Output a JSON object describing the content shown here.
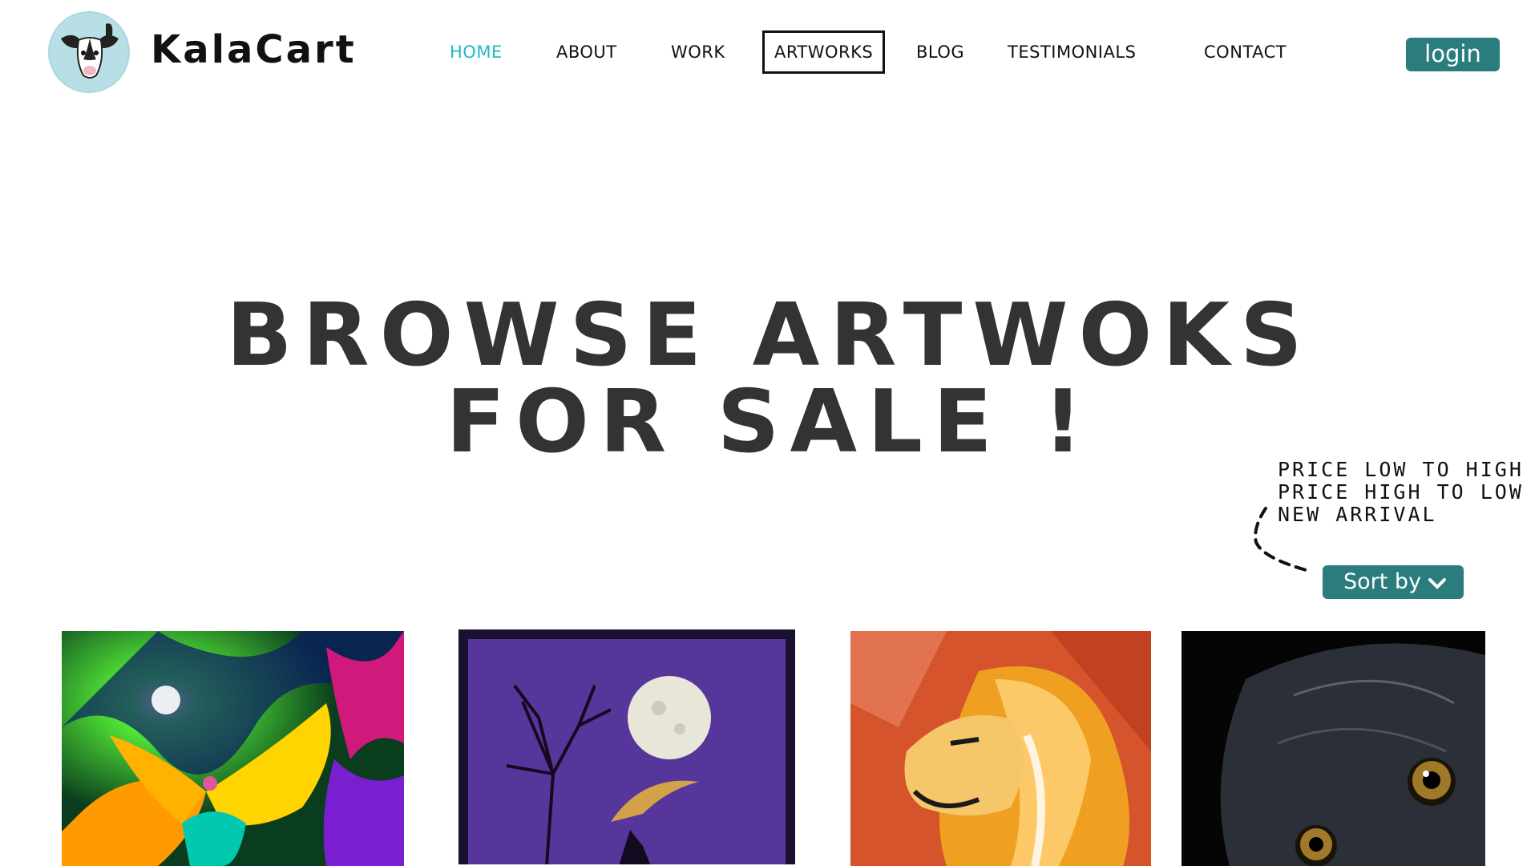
{
  "brand": {
    "name": "KalaCart",
    "logo_icon": "goat-icon"
  },
  "nav": {
    "items": [
      {
        "label": "HOME",
        "active": true
      },
      {
        "label": "ABOUT"
      },
      {
        "label": "WORK"
      },
      {
        "label": "ARTWORKS",
        "boxed": true
      },
      {
        "label": "BLOG"
      },
      {
        "label": "TESTIMONIALS"
      },
      {
        "label": "CONTACT"
      }
    ],
    "login_label": "login"
  },
  "hero": {
    "line1": "BROWSE ARTWOKS",
    "line2": "FOR SALE !"
  },
  "sort": {
    "options": [
      "PRICE LOW TO HIGH",
      "PRICE HIGH TO LOW",
      "NEW ARRIVAL"
    ],
    "button_label": "Sort by",
    "button_icon": "chevron-down-icon"
  },
  "artworks": [
    {
      "subject": "colorful-fairy-painting"
    },
    {
      "subject": "moon-tree-night-painting"
    },
    {
      "subject": "lion-painting"
    },
    {
      "subject": "black-monkey-painting"
    }
  ],
  "colors": {
    "accent": "#2b7c7c",
    "active_nav": "#20b8c4",
    "text": "#111111",
    "hero_text": "#333333"
  }
}
